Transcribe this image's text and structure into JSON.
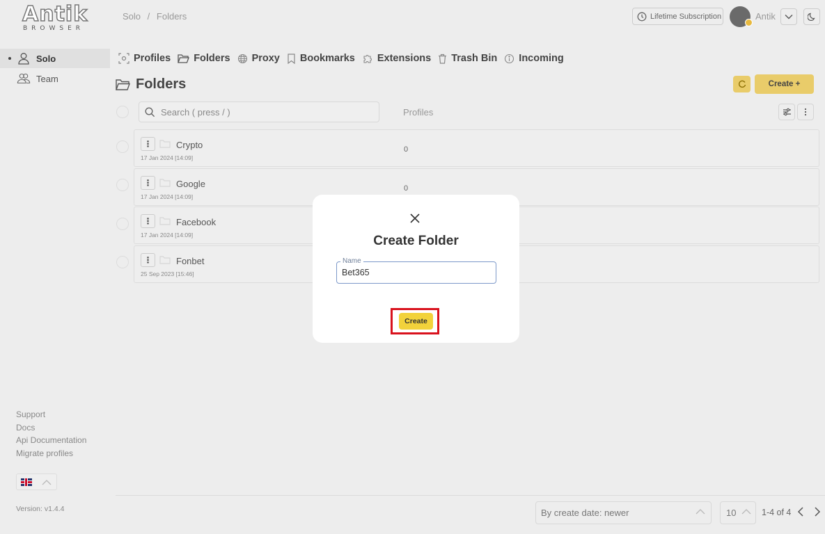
{
  "sidebar": {
    "logo_main": "Antik",
    "logo_sub": "BROWSER",
    "items": [
      {
        "label": "Solo",
        "active": true
      },
      {
        "label": "Team",
        "active": false
      }
    ],
    "footer_links": [
      "Support",
      "Docs",
      "Api Documentation",
      "Migrate profiles"
    ],
    "language": "en-GB",
    "version": "Version: v1.4.4"
  },
  "header": {
    "breadcrumb": [
      "Solo",
      "/",
      "Folders"
    ],
    "subscription_label": "Lifetime Subscription",
    "user_name": "Antik"
  },
  "tabs": [
    {
      "label": "Profiles",
      "icon": "profiles-icon"
    },
    {
      "label": "Folders",
      "icon": "folder-icon"
    },
    {
      "label": "Proxy",
      "icon": "globe-icon"
    },
    {
      "label": "Bookmarks",
      "icon": "bookmark-icon"
    },
    {
      "label": "Extensions",
      "icon": "puzzle-icon"
    },
    {
      "label": "Trash Bin",
      "icon": "trash-icon"
    },
    {
      "label": "Incoming",
      "icon": "info-icon"
    }
  ],
  "main": {
    "title": "Folders",
    "create_label": "Create +",
    "search_placeholder": "Search ( press / )",
    "column_header": "Profiles",
    "rows": [
      {
        "name": "Crypto",
        "date": "17 Jan 2024 [14:09]",
        "count": "0"
      },
      {
        "name": "Google",
        "date": "17 Jan 2024 [14:09]",
        "count": "0"
      },
      {
        "name": "Facebook",
        "date": "17 Jan 2024 [14:09]",
        "count": ""
      },
      {
        "name": "Fonbet",
        "date": "25 Sep 2023 [15:46]",
        "count": ""
      }
    ]
  },
  "footer": {
    "sort_value": "By create date: newer",
    "per_page": "10",
    "page_info": "1-4 of 4"
  },
  "modal": {
    "title": "Create Folder",
    "field_label": "Name",
    "field_value": "Bet365",
    "create_label": "Create"
  },
  "colors": {
    "accent": "#e9cc6a",
    "modal_button": "#f2d23b",
    "highlight": "#d9121d"
  }
}
